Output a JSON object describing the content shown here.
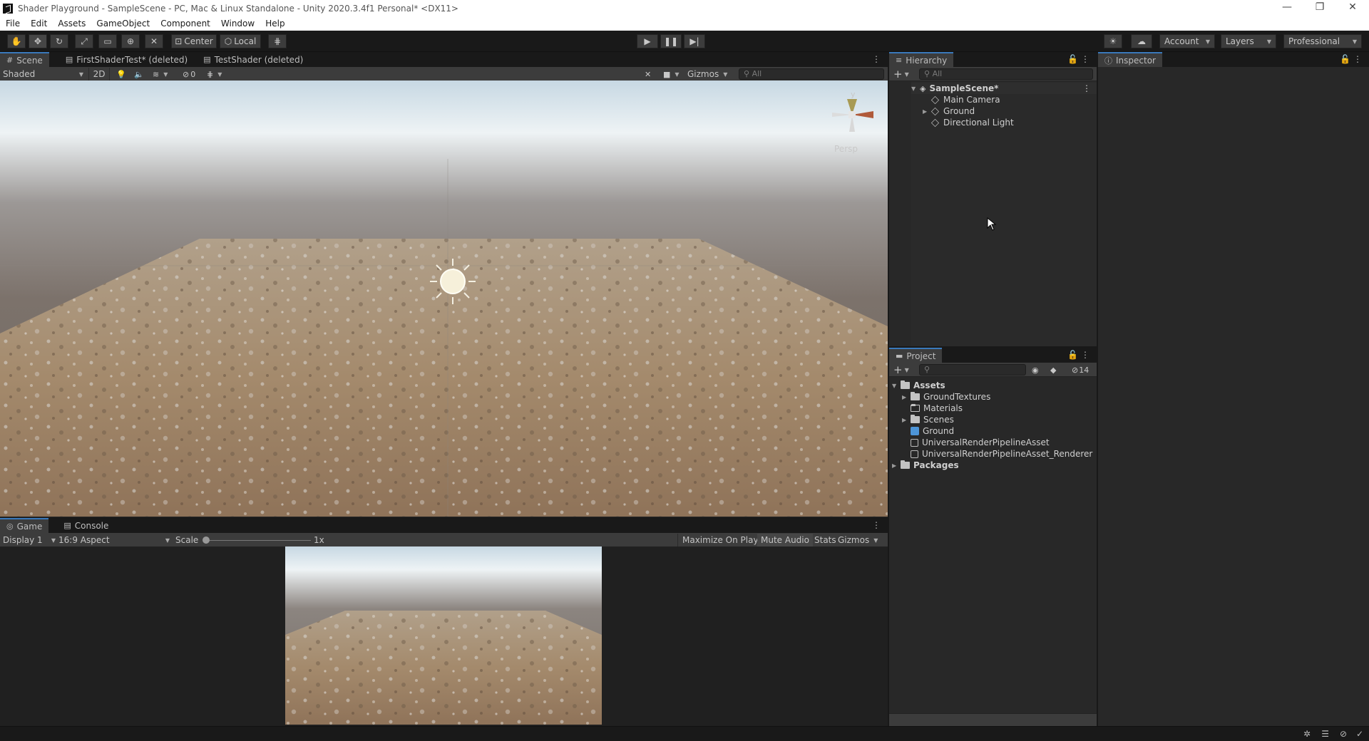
{
  "window": {
    "title": "Shader Playground - SampleScene - PC, Mac & Linux Standalone - Unity 2020.3.4f1 Personal* <DX11>",
    "controls": [
      "—",
      "❐",
      "✕"
    ]
  },
  "menu": [
    "File",
    "Edit",
    "Assets",
    "GameObject",
    "Component",
    "Window",
    "Help"
  ],
  "toolbar": {
    "pivot_label": "Center",
    "space_label": "Local",
    "account_label": "Account",
    "layers_label": "Layers",
    "layout_label": "Professional"
  },
  "scene_panel": {
    "tabs": [
      {
        "icon": "scene-icon",
        "label": "Scene"
      },
      {
        "icon": "shader-icon",
        "label": "FirstShaderTest* (deleted)"
      },
      {
        "icon": "shader-icon",
        "label": "TestShader (deleted)"
      }
    ],
    "draw_mode": "Shaded",
    "mode_2d": "2D",
    "hidden_count": "0",
    "gizmos_label": "Gizmos",
    "search_placeholder": "All",
    "persp_label": "Persp",
    "axis_y": "y"
  },
  "game_panel": {
    "tabs": [
      {
        "icon": "game-icon",
        "label": "Game"
      },
      {
        "icon": "console-icon",
        "label": "Console"
      }
    ],
    "display": "Display 1",
    "aspect": "16:9 Aspect",
    "scale_label": "Scale",
    "scale_value": "1x",
    "maximize_label": "Maximize On Play",
    "mute_label": "Mute Audio",
    "stats_label": "Stats",
    "gizmos_label": "Gizmos"
  },
  "hierarchy": {
    "title": "Hierarchy",
    "search_placeholder": "All",
    "scene": "SampleScene*",
    "items": [
      "Main Camera",
      "Ground",
      "Directional Light"
    ]
  },
  "project": {
    "title": "Project",
    "hidden_count": "14",
    "root": "Assets",
    "assets": [
      "GroundTextures",
      "Materials",
      "Scenes",
      "Ground",
      "UniversalRenderPipelineAsset",
      "UniversalRenderPipelineAsset_Renderer"
    ],
    "packages": "Packages"
  },
  "inspector": {
    "title": "Inspector"
  },
  "colors": {
    "selection_accent": "#3a79bb",
    "panel_bg": "#282828",
    "toolbar_bg": "#191919",
    "sky_top": "#e6eff4",
    "ground_sand": "#a08567"
  }
}
